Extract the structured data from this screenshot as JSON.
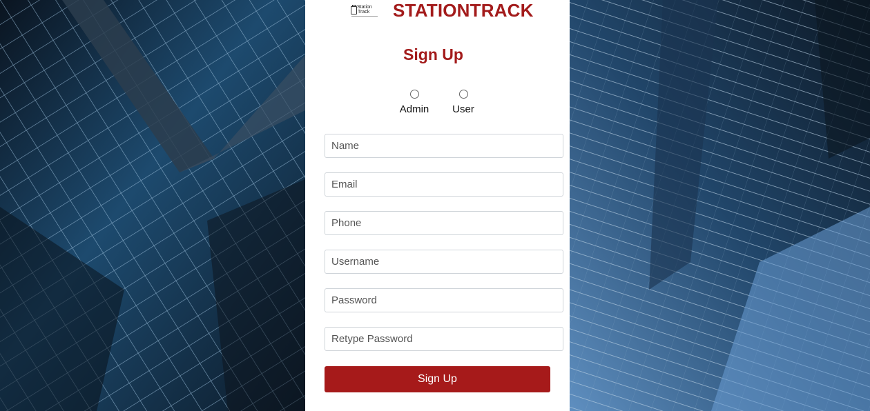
{
  "brand": {
    "logo_text_line1": "Station",
    "logo_text_line2": "Track",
    "name": "STATIONTRACK"
  },
  "form": {
    "title": "Sign Up",
    "roles": [
      {
        "label": "Admin",
        "selected": false
      },
      {
        "label": "User",
        "selected": false
      }
    ],
    "fields": {
      "name": {
        "placeholder": "Name",
        "value": ""
      },
      "email": {
        "placeholder": "Email",
        "value": ""
      },
      "phone": {
        "placeholder": "Phone",
        "value": ""
      },
      "username": {
        "placeholder": "Username",
        "value": ""
      },
      "password": {
        "placeholder": "Password",
        "value": ""
      },
      "retype_password": {
        "placeholder": "Retype Password",
        "value": ""
      }
    },
    "submit_label": "Sign Up"
  },
  "colors": {
    "brand_red": "#a31b1b",
    "button_red": "#a61a1a",
    "card_bg": "#ffffff"
  }
}
